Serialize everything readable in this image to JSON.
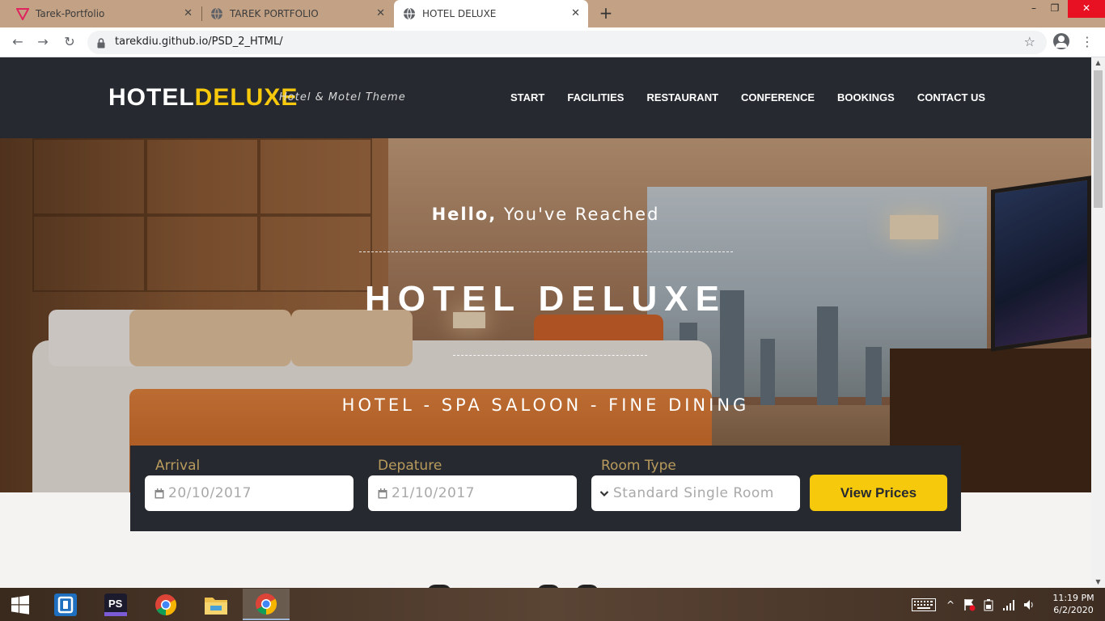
{
  "browser": {
    "tabs": [
      {
        "title": "Tarek-Portfolio",
        "favicon": "triangle-logo-icon"
      },
      {
        "title": "TAREK PORTFOLIO",
        "favicon": "globe-icon"
      },
      {
        "title": "HOTEL DELUXE",
        "favicon": "globe-icon",
        "active": true
      }
    ],
    "new_tab_label": "+",
    "url": "tarekdiu.github.io/PSD_2_HTML/",
    "window_controls": {
      "minimize": "–",
      "restore": "❐",
      "close": "✕"
    }
  },
  "site": {
    "logo_main": "HOTEL",
    "logo_accent": "DELUXE",
    "tagline": "Hotel & Motel Theme",
    "nav": [
      "START",
      "FACILITIES",
      "RESTAURANT",
      "CONFERENCE",
      "BOOKINGS",
      "CONTACT US"
    ],
    "hero": {
      "hello_bold": "Hello,",
      "hello_rest": "You've Reached",
      "title": "HOTEL DELUXE",
      "subtitle": "HOTEL - SPA SALOON - FINE DINING"
    },
    "booking": {
      "arrival_label": "Arrival",
      "arrival_value": "20/10/2017",
      "departure_label": "Depature",
      "departure_value": "21/10/2017",
      "room_label": "Room Type",
      "room_value": "Standard Single Room",
      "button": "View Prices"
    },
    "colors": {
      "accent": "#f7c90c",
      "dark": "#262a30",
      "label": "#b99a5d"
    }
  },
  "taskbar": {
    "apps": [
      "windows-start-icon",
      "screen-recorder-icon",
      "photoshop-icon",
      "chrome-icon",
      "file-explorer-icon",
      "chrome-icon"
    ],
    "photoshop_label": "PS",
    "time": "11:19 PM",
    "date": "6/2/2020"
  }
}
